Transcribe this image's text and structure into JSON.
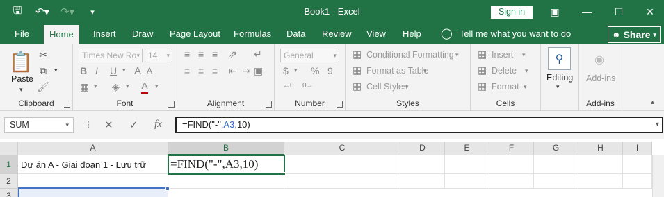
{
  "title_bar": {
    "title": "Book1  -  Excel",
    "sign_in": "Sign in"
  },
  "tabs": [
    "File",
    "Home",
    "Insert",
    "Draw",
    "Page Layout",
    "Formulas",
    "Data",
    "Review",
    "View",
    "Help"
  ],
  "tell_me": "Tell me what you want to do",
  "share": "Share",
  "ribbon": {
    "clipboard": {
      "paste": "Paste",
      "label": "Clipboard"
    },
    "font": {
      "name": "Times New Ro",
      "size": "14",
      "label": "Font",
      "bold": "B",
      "italic": "I",
      "underline": "U",
      "font_color": "A",
      "grow": "A",
      "shrink": "A"
    },
    "alignment": {
      "label": "Alignment"
    },
    "number": {
      "format": "General",
      "label": "Number",
      "currency": "$",
      "percent": "%",
      "comma": "9"
    },
    "styles": {
      "conditional": "Conditional Formatting",
      "format_table": "Format as Table",
      "cell_styles": "Cell Styles",
      "label": "Styles"
    },
    "cells": {
      "insert": "Insert",
      "delete": "Delete",
      "format": "Format",
      "label": "Cells"
    },
    "editing": {
      "label": "Editing"
    },
    "addins": {
      "button": "Add-ins",
      "label": "Add-ins"
    }
  },
  "formula_bar": {
    "name_box": "SUM",
    "fx": "fx",
    "formula_pre": "=FIND(\"-\",",
    "formula_ref": "A3",
    "formula_post": ",10)"
  },
  "columns": [
    "A",
    "B",
    "C",
    "D",
    "E",
    "F",
    "G",
    "H",
    "I"
  ],
  "rows": [
    "1",
    "2",
    "3"
  ],
  "cells": {
    "A1": "Dự án A - Giai đoạn 1 - Lưu trữ",
    "B1": "=FIND(\"-\",A3,10)"
  },
  "colors": {
    "accent": "#217346",
    "ref_blue": "#3366cc"
  }
}
